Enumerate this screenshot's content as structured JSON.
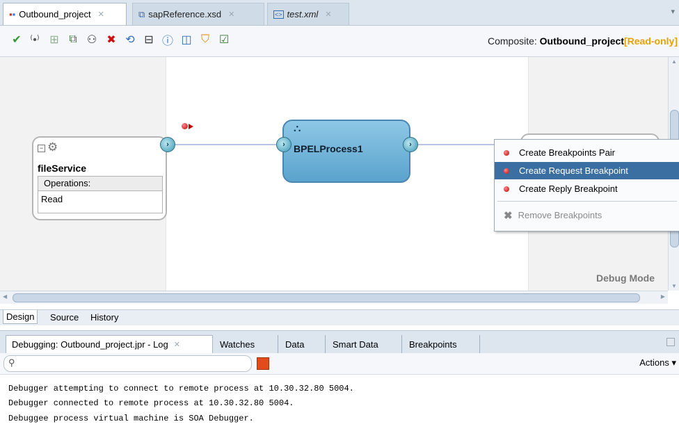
{
  "editor_tabs": [
    {
      "label": "Outbound_project",
      "icon": "composite-icon",
      "active": true
    },
    {
      "label": "sapReference.xsd",
      "icon": "schema-icon",
      "active": false
    },
    {
      "label": "test.xml",
      "icon": "xml-icon",
      "active": false
    }
  ],
  "toolbar": {
    "composite_prefix": "Composite: ",
    "composite_name": "Outbound_project",
    "composite_suffix": "[Read-only]"
  },
  "canvas": {
    "file_service": {
      "name": "fileService",
      "operations_header": "Operations:",
      "operation": "Read"
    },
    "bpel": {
      "name": "BPELProcess1"
    },
    "debug_mode": "Debug Mode"
  },
  "context_menu": {
    "items": [
      {
        "label": "Create Breakpoints Pair",
        "icon": "breakpoint-icon",
        "state": "normal"
      },
      {
        "label": "Create Request Breakpoint",
        "icon": "breakpoint-icon",
        "state": "selected"
      },
      {
        "label": "Create Reply Breakpoint",
        "icon": "breakpoint-icon",
        "state": "normal"
      },
      {
        "label": "Remove Breakpoints",
        "icon": "remove-icon",
        "state": "disabled"
      }
    ]
  },
  "design_tabs": [
    "Design",
    "Source",
    "History"
  ],
  "log_tabs": [
    {
      "label": "Debugging: Outbound_project.jpr - Log",
      "active": true
    },
    {
      "label": "Watches",
      "active": false
    },
    {
      "label": "Data",
      "active": false
    },
    {
      "label": "Smart Data",
      "active": false
    },
    {
      "label": "Breakpoints",
      "active": false
    }
  ],
  "log_toolbar": {
    "actions_label": "Actions ▾"
  },
  "log_lines": [
    "Debugger attempting to connect to remote process at 10.30.32.80 5004.",
    "Debugger connected to remote process at 10.30.32.80 5004.",
    "Debuggee process virtual machine is SOA Debugger."
  ],
  "colors": {
    "read_only": "#e8a200",
    "selection": "#3b6ea1",
    "breakpoint": "#c00000"
  }
}
